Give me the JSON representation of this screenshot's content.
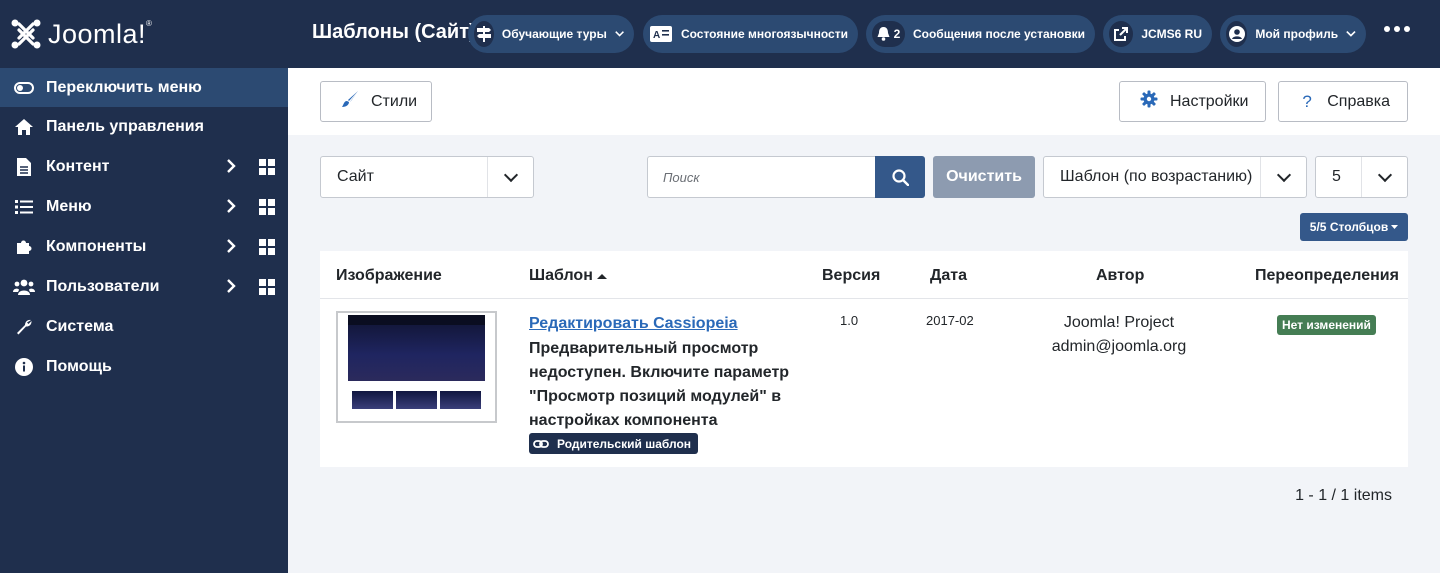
{
  "app": {
    "logo_text": "Joomla!",
    "logo_mark": "®"
  },
  "sidebar": {
    "toggle_label": "Переключить меню",
    "items": [
      {
        "label": "Панель управления",
        "icon": "home-icon",
        "has_submenu": false
      },
      {
        "label": "Контент",
        "icon": "file-icon",
        "has_submenu": true
      },
      {
        "label": "Меню",
        "icon": "list-icon",
        "has_submenu": true
      },
      {
        "label": "Компоненты",
        "icon": "puzzle-icon",
        "has_submenu": true
      },
      {
        "label": "Пользователи",
        "icon": "users-icon",
        "has_submenu": true
      },
      {
        "label": "Система",
        "icon": "wrench-icon",
        "has_submenu": false
      },
      {
        "label": "Помощь",
        "icon": "info-icon",
        "has_submenu": false
      }
    ]
  },
  "header": {
    "title": "Шаблоны (Сайт)",
    "tours_label": "Обучающие туры",
    "multilang_label": "Состояние многоязычности",
    "notifications_count": "2",
    "postinstall_label": "Сообщения после установки",
    "site_label": "JCMS6 RU",
    "profile_label": "Мой профиль"
  },
  "toolbar": {
    "styles_label": "Стили",
    "options_label": "Настройки",
    "help_label": "Справка"
  },
  "filters": {
    "client_value": "Сайт",
    "search_placeholder": "Поиск",
    "clear_label": "Очистить",
    "sort_value": "Шаблон (по возрастанию)",
    "limit_value": "5",
    "columns_label": "5/5 Столбцов"
  },
  "table": {
    "headers": {
      "image": "Изображение",
      "template": "Шаблон",
      "version": "Версия",
      "date": "Дата",
      "author": "Автор",
      "overrides": "Переопределения"
    },
    "rows": [
      {
        "edit_link": "Редактировать Cassiopeia",
        "description": "Предварительный просмотр недоступен. Включите параметр \"Просмотр позиций модулей\" в настройках компонента",
        "badge": "Родительский шаблон",
        "version": "1.0",
        "date": "2017-02",
        "author_name": "Joomla! Project",
        "author_email": "admin@joomla.org",
        "overrides": "Нет изменений"
      }
    ]
  },
  "pagination": {
    "text": "1 - 1 / 1 items"
  },
  "colors": {
    "sidebar_bg": "#1f2f4d",
    "accent": "#34588a",
    "link": "#2a69b8",
    "success": "#457d54"
  }
}
